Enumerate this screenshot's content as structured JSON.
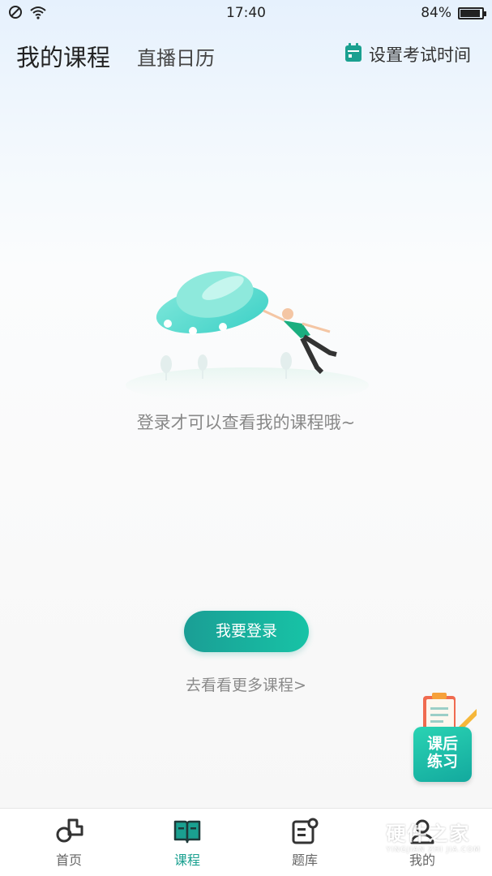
{
  "status_bar": {
    "time": "17:40",
    "battery": "84%",
    "battery_level": 0.84
  },
  "header": {
    "title": "我的课程",
    "subtitle": "直播日历",
    "exam_label": "设置考试时间"
  },
  "empty_state": {
    "message": "登录才可以查看我的课程哦~"
  },
  "actions": {
    "login_label": "我要登录",
    "more_label": "去看看更多课程>"
  },
  "floating": {
    "line1": "课后",
    "line2": "练习"
  },
  "tabbar": {
    "items": [
      {
        "label": "首页",
        "icon": "home-icon"
      },
      {
        "label": "课程",
        "icon": "book-icon"
      },
      {
        "label": "题库",
        "icon": "question-bank-icon"
      },
      {
        "label": "我的",
        "icon": "profile-icon"
      }
    ],
    "active_index": 1
  },
  "watermark": {
    "text": "硬件之家",
    "sub": "YINGJIAN ZHI JIA.COM"
  },
  "colors": {
    "accent": "#1aa090",
    "accent_light": "#17c3a6"
  }
}
